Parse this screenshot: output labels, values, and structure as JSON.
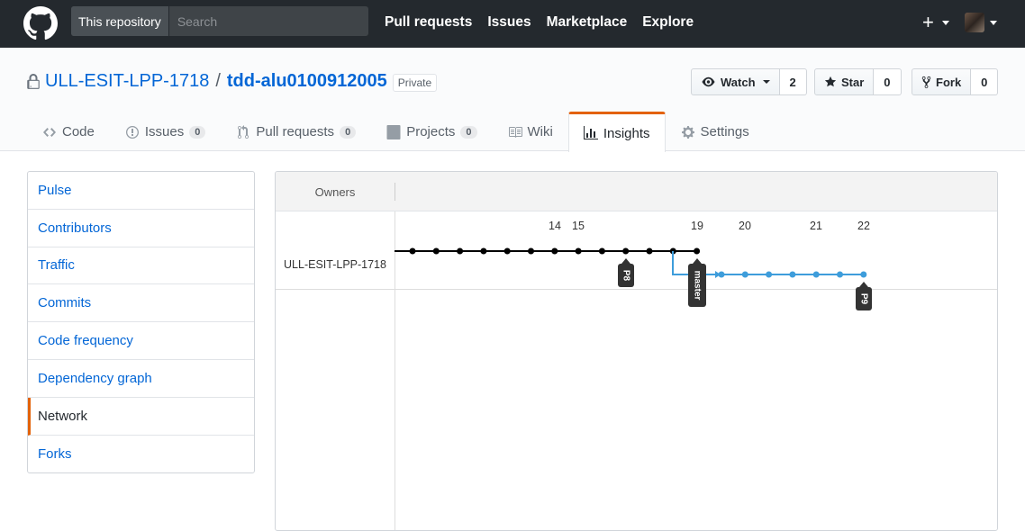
{
  "header": {
    "search_scope": "This repository",
    "search_placeholder": "Search",
    "nav": [
      "Pull requests",
      "Issues",
      "Marketplace",
      "Explore"
    ],
    "plus": "+"
  },
  "repo": {
    "owner": "ULL-ESIT-LPP-1718",
    "separator": "/",
    "name": "tdd-alu0100912005",
    "visibility": "Private",
    "watch_label": "Watch",
    "watch_count": "2",
    "star_label": "Star",
    "star_count": "0",
    "fork_label": "Fork",
    "fork_count": "0"
  },
  "tabs": [
    {
      "label": "Code",
      "icon": "code-icon"
    },
    {
      "label": "Issues",
      "count": "0",
      "icon": "issue-icon"
    },
    {
      "label": "Pull requests",
      "count": "0",
      "icon": "pull-request-icon"
    },
    {
      "label": "Projects",
      "count": "0",
      "icon": "project-icon"
    },
    {
      "label": "Wiki",
      "icon": "book-icon"
    },
    {
      "label": "Insights",
      "icon": "graph-icon",
      "selected": true
    },
    {
      "label": "Settings",
      "icon": "gear-icon"
    }
  ],
  "sidebar": {
    "items": [
      {
        "label": "Pulse"
      },
      {
        "label": "Contributors"
      },
      {
        "label": "Traffic"
      },
      {
        "label": "Commits"
      },
      {
        "label": "Code frequency"
      },
      {
        "label": "Dependency graph"
      },
      {
        "label": "Network",
        "selected": true
      },
      {
        "label": "Forks"
      }
    ]
  },
  "network": {
    "owners_label": "Owners",
    "owner": "ULL-ESIT-LPP-1718",
    "dates": [
      "14",
      "15",
      "19",
      "20",
      "21",
      "22"
    ],
    "branches": [
      {
        "name": "P8",
        "color": "#000000",
        "commits": 13
      },
      {
        "name": "master",
        "color": "#000000"
      },
      {
        "name": "P9",
        "color": "#3e9ddb",
        "commits": 7
      }
    ]
  }
}
